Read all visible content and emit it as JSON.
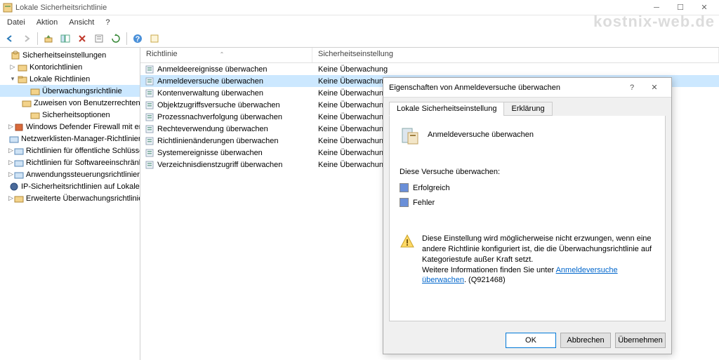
{
  "window": {
    "title": "Lokale Sicherheitsrichtlinie"
  },
  "menu": {
    "file": "Datei",
    "action": "Aktion",
    "view": "Ansicht",
    "help": "?"
  },
  "watermark": "kostnix-web.de",
  "tree": {
    "root": "Sicherheitseinstellungen",
    "account": "Kontorichtlinien",
    "local": "Lokale Richtlinien",
    "audit": "Überwachungsrichtlinie",
    "rights": "Zuweisen von Benutzerrechten",
    "secopts": "Sicherheitsoptionen",
    "firewall": "Windows Defender Firewall mit erweit",
    "netlist": "Netzwerklisten-Manager-Richtlinien",
    "pubkey": "Richtlinien für öffentliche Schlüssel",
    "software": "Richtlinien für Softwareeinschränkung",
    "appctl": "Anwendungssteuerungsrichtlinien",
    "ipsec": "IP-Sicherheitsrichtlinien auf Lokaler C",
    "advaudit": "Erweiterte Überwachungsrichtlinienko"
  },
  "columns": {
    "policy": "Richtlinie",
    "setting": "Sicherheitseinstellung"
  },
  "policies": [
    {
      "name": "Anmeldeereignisse überwachen",
      "setting": "Keine Überwachung"
    },
    {
      "name": "Anmeldeversuche überwachen",
      "setting": "Keine Überwachung"
    },
    {
      "name": "Kontenverwaltung überwachen",
      "setting": "Keine Überwachung"
    },
    {
      "name": "Objektzugriffsversuche überwachen",
      "setting": "Keine Überwachung"
    },
    {
      "name": "Prozessnachverfolgung überwachen",
      "setting": "Keine Überwachung"
    },
    {
      "name": "Rechteverwendung überwachen",
      "setting": "Keine Überwachung"
    },
    {
      "name": "Richtlinienänderungen überwachen",
      "setting": "Keine Überwachung"
    },
    {
      "name": "Systemereignisse überwachen",
      "setting": "Keine Überwachung"
    },
    {
      "name": "Verzeichnisdienstzugriff überwachen",
      "setting": "Keine Überwachung"
    }
  ],
  "dialog": {
    "title": "Eigenschaften von Anmeldeversuche überwachen",
    "tab_setting": "Lokale Sicherheitseinstellung",
    "tab_explain": "Erklärung",
    "policy_name": "Anmeldeversuche überwachen",
    "section_label": "Diese Versuche überwachen:",
    "check_success": "Erfolgreich",
    "check_fail": "Fehler",
    "warning_text": "Diese Einstellung wird möglicherweise nicht erzwungen, wenn eine andere Richtlinie konfiguriert ist, die die Überwachungsrichtlinie auf Kategoriestufe außer Kraft setzt.",
    "warning_more": "Weitere Informationen finden Sie unter ",
    "warning_link": "Anmeldeversuche überwachen",
    "warning_kb": ". (Q921468)",
    "btn_ok": "OK",
    "btn_cancel": "Abbrechen",
    "btn_apply": "Übernehmen"
  }
}
